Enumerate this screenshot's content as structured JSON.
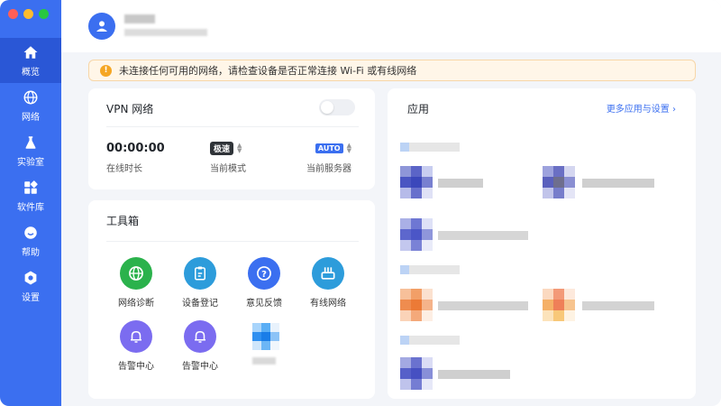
{
  "sidebar": {
    "items": [
      {
        "label": "概览",
        "icon": "home-icon",
        "active": true
      },
      {
        "label": "网络",
        "icon": "globe-icon"
      },
      {
        "label": "实验室",
        "icon": "flask-icon"
      },
      {
        "label": "软件库",
        "icon": "apps-grid-icon"
      },
      {
        "label": "帮助",
        "icon": "help-icon"
      },
      {
        "label": "设置",
        "icon": "gear-icon"
      }
    ]
  },
  "alert": {
    "text": "未连接任何可用的网络，请检查设备是否正常连接 Wi-Fi 或有线网络"
  },
  "vpn": {
    "title": "VPN 网络",
    "online_time": "00:00:00",
    "online_time_label": "在线时长",
    "mode_badge": "极速",
    "mode_label": "当前模式",
    "server_badge": "AUTO",
    "server_label": "当前服务器"
  },
  "toolbox": {
    "title": "工具箱",
    "tools": [
      {
        "label": "网络诊断",
        "icon": "globe-icon",
        "color": "#2bb24c"
      },
      {
        "label": "设备登记",
        "icon": "clipboard-icon",
        "color": "#2d9cdb"
      },
      {
        "label": "意见反馈",
        "icon": "question-icon",
        "color": "#3b6ff0"
      },
      {
        "label": "有线网络",
        "icon": "router-icon",
        "color": "#2d9cdb"
      },
      {
        "label": "告警中心",
        "icon": "bell-icon",
        "color": "#7b6cf0"
      },
      {
        "label": "告警中心",
        "icon": "bell-icon",
        "color": "#7b6cf0"
      }
    ]
  },
  "apps": {
    "title": "应用",
    "more_link": "更多应用与设置 ›"
  }
}
